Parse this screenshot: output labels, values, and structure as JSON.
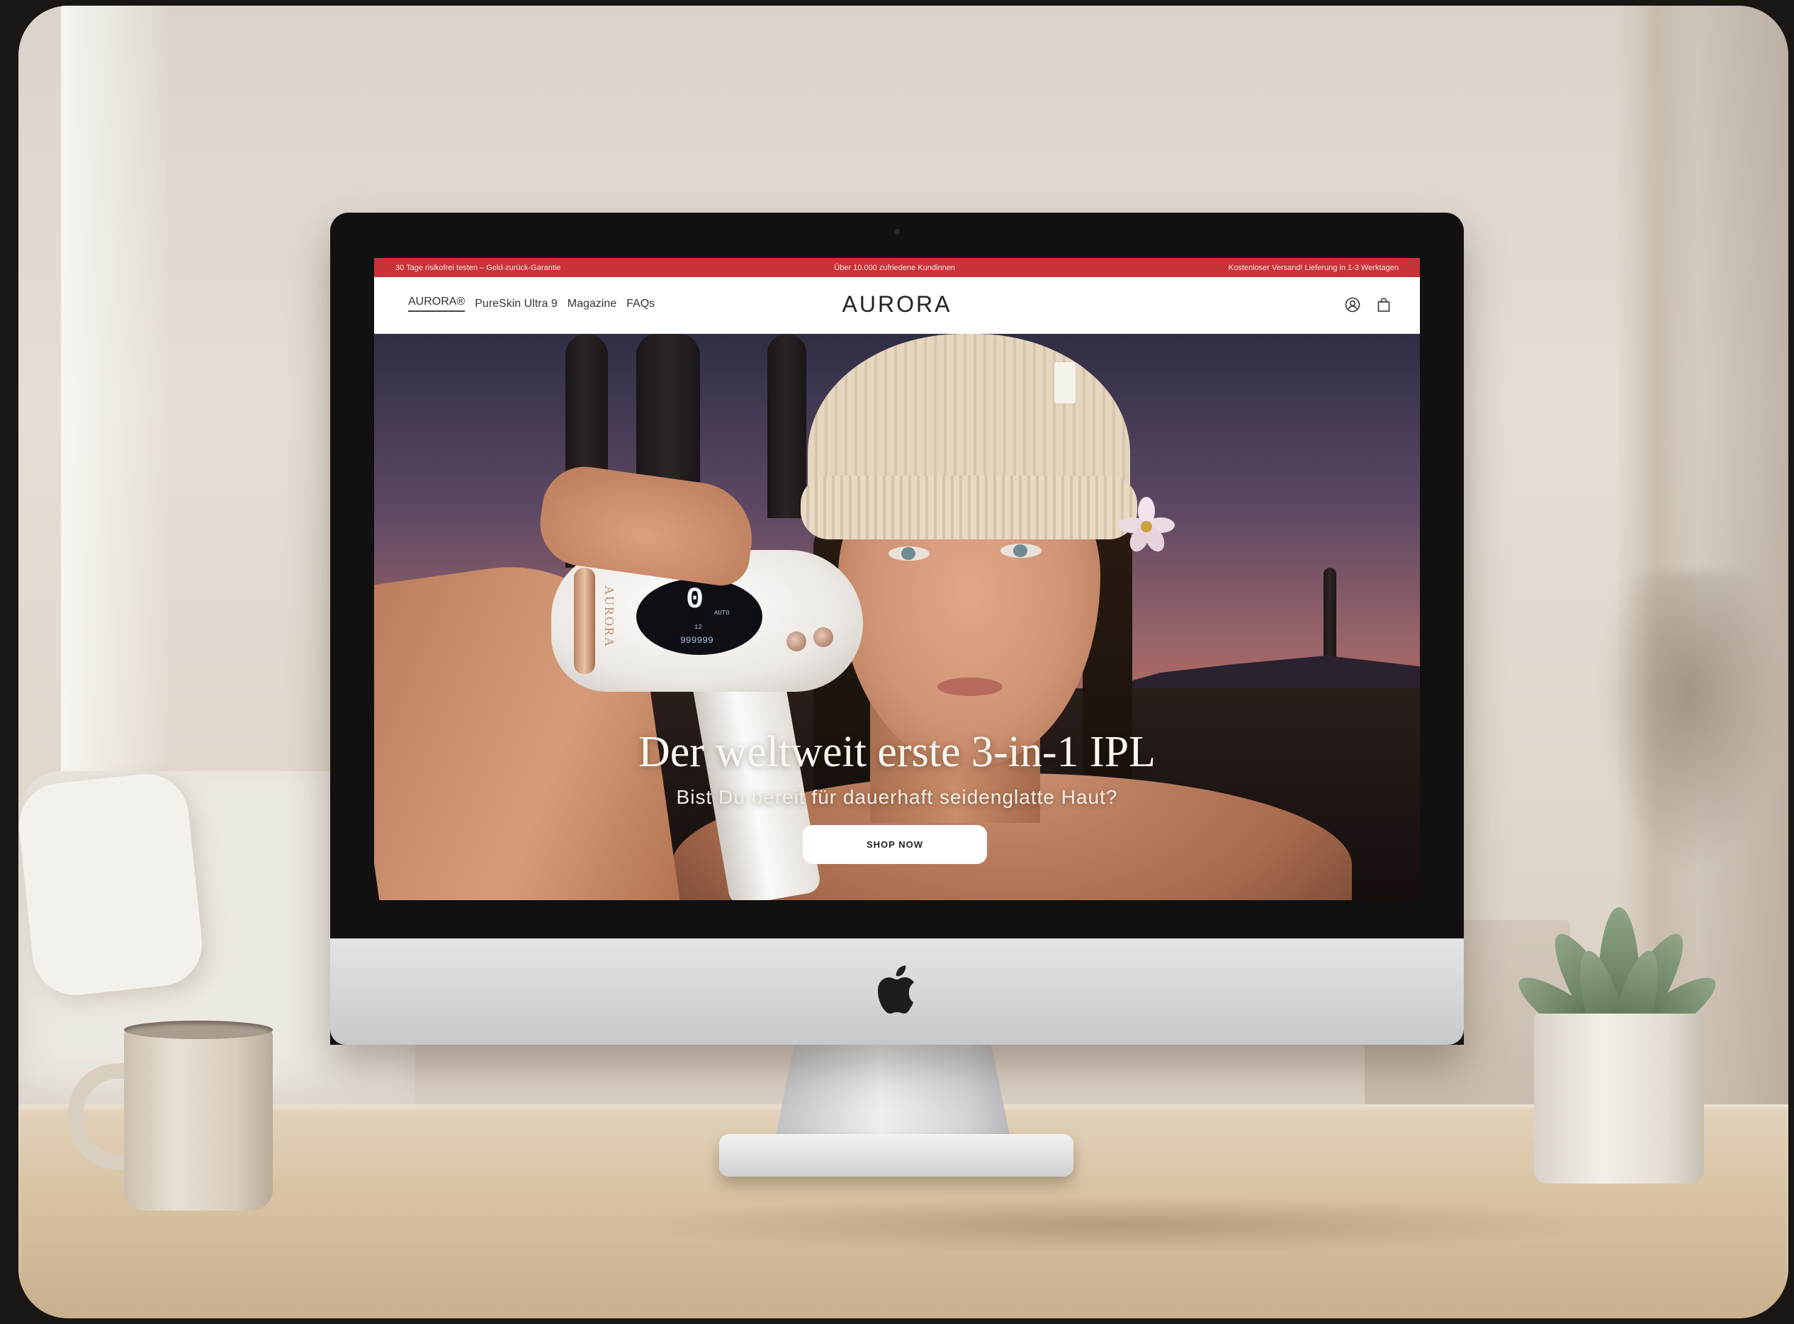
{
  "announcement_bar": {
    "left": "30 Tage risikofrei testen – Geld-zurück-Garantie",
    "center": "Über 10.000 zufriedene Kundinnen",
    "right": "Kostenloser Versand! Lieferung in 1-3 Werktagen",
    "color": "#c8333a"
  },
  "nav": {
    "links": [
      "AURORA®",
      "PureSkin Ultra 9",
      "Magazine",
      "FAQs"
    ],
    "active_index": 0,
    "logo": "AURORA",
    "icons": [
      "account-icon",
      "shopping-bag-icon"
    ]
  },
  "hero": {
    "title": "Der weltweit erste 3-in-1 IPL",
    "subtitle": "Bist Du bereit für dauerhaft seidenglatte Haut?",
    "cta_label": "SHOP NOW",
    "device": {
      "brand": "AURORA",
      "display_digit": "0",
      "display_small_1": "AUTO",
      "display_small_2": "12",
      "display_small_3": "999999"
    }
  },
  "hardware": {
    "logo_icon": "apple-logo-icon"
  }
}
